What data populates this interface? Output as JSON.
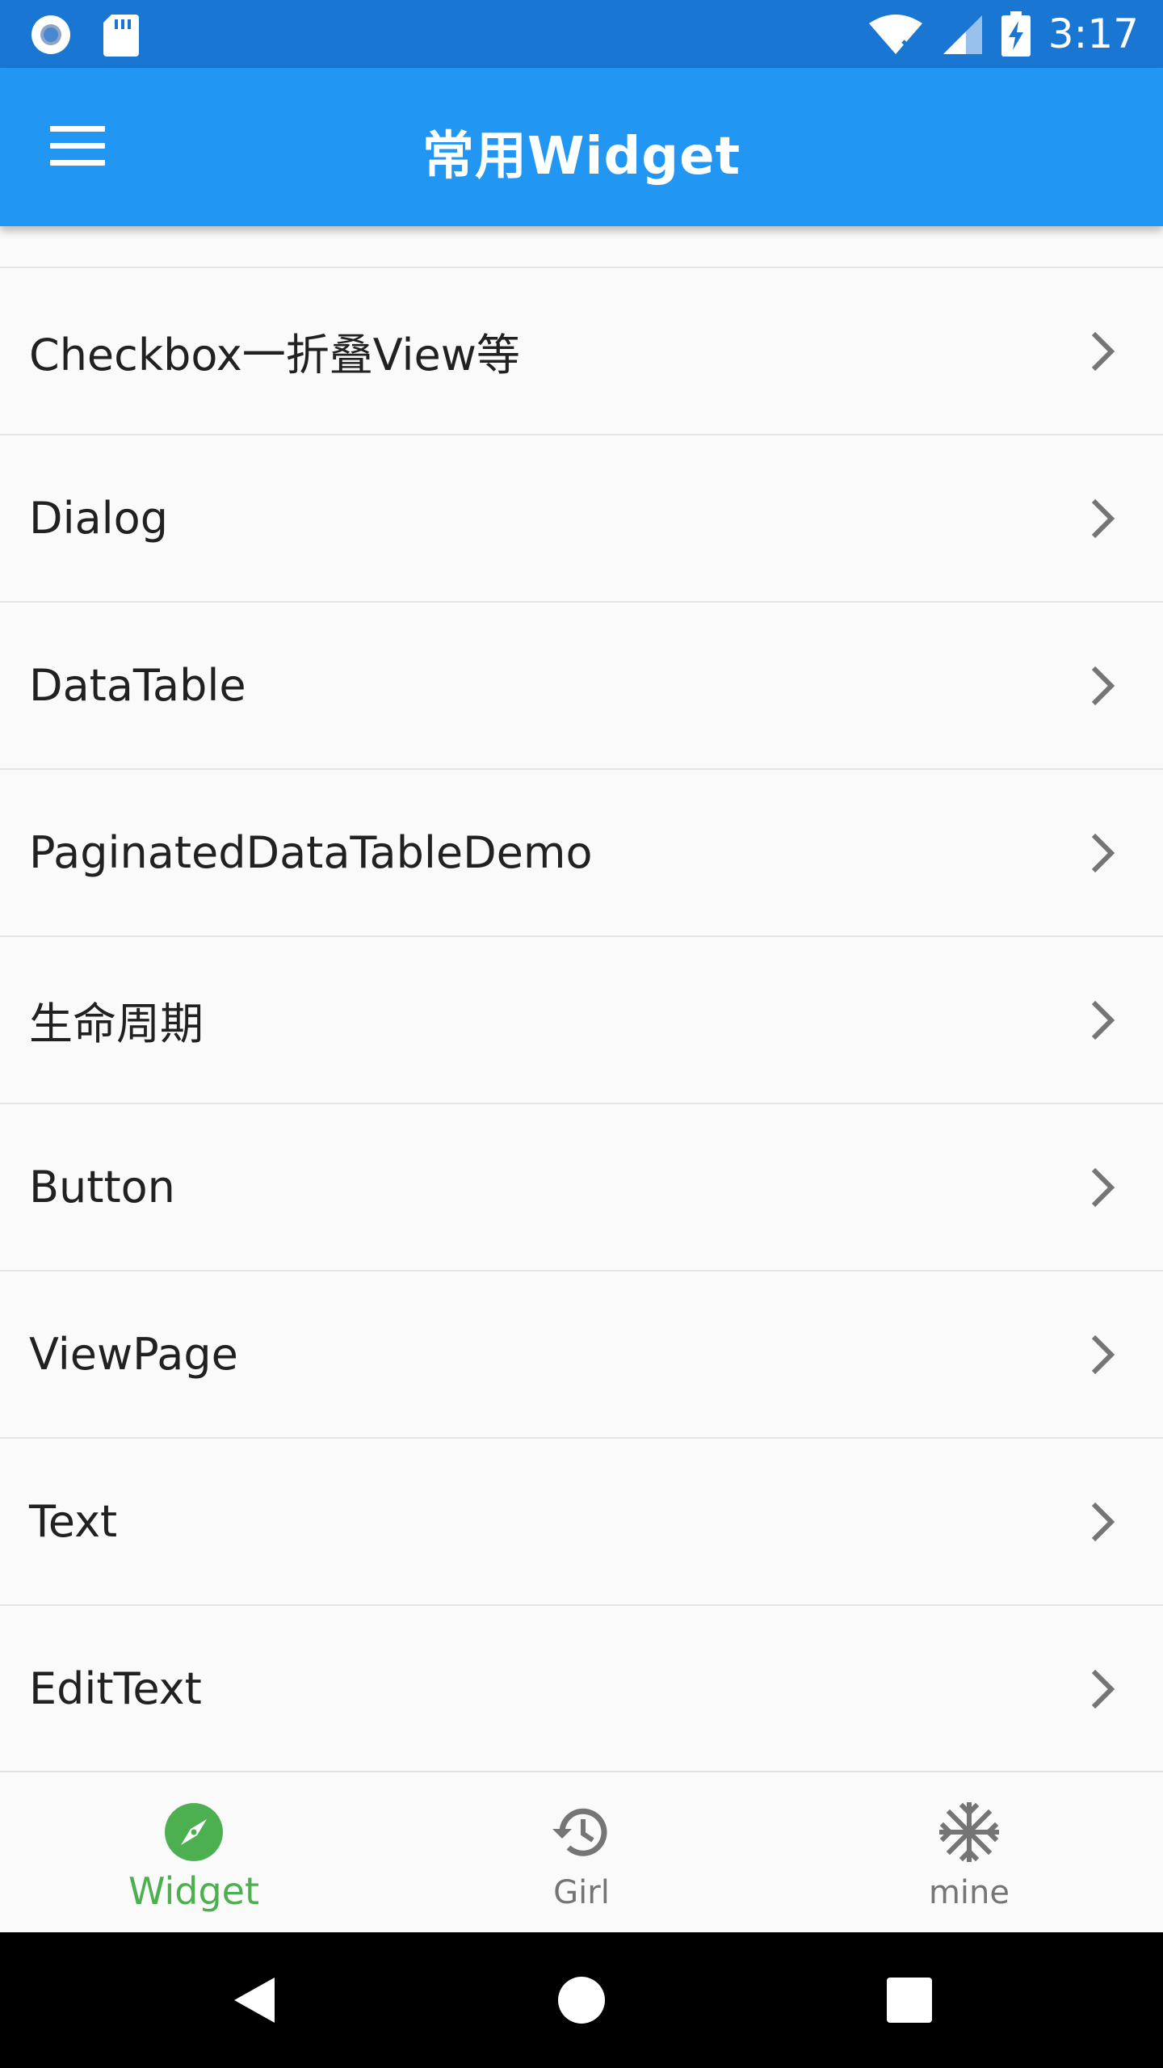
{
  "status_bar": {
    "time": "3:17",
    "icons": [
      "record-icon",
      "sd-card-icon",
      "wifi-icon",
      "signal-icon",
      "battery-charging-icon"
    ]
  },
  "app_bar": {
    "title": "常用Widget",
    "menu_icon": "menu-icon"
  },
  "list": {
    "items": [
      {
        "label": "Checkbox一折叠View等"
      },
      {
        "label": "Dialog"
      },
      {
        "label": "DataTable"
      },
      {
        "label": "PaginatedDataTableDemo"
      },
      {
        "label": "生命周期"
      },
      {
        "label": "Button"
      },
      {
        "label": "ViewPage"
      },
      {
        "label": "Text"
      },
      {
        "label": "EditText"
      }
    ]
  },
  "bottom_nav": {
    "items": [
      {
        "label": "Widget",
        "icon": "compass-icon",
        "active": true
      },
      {
        "label": "Girl",
        "icon": "history-icon",
        "active": false
      },
      {
        "label": "mine",
        "icon": "snowflake-icon",
        "active": false
      }
    ]
  },
  "colors": {
    "status_bar": "#1976d2",
    "app_bar": "#2196f3",
    "active": "#4caf50",
    "inactive": "#757575"
  }
}
